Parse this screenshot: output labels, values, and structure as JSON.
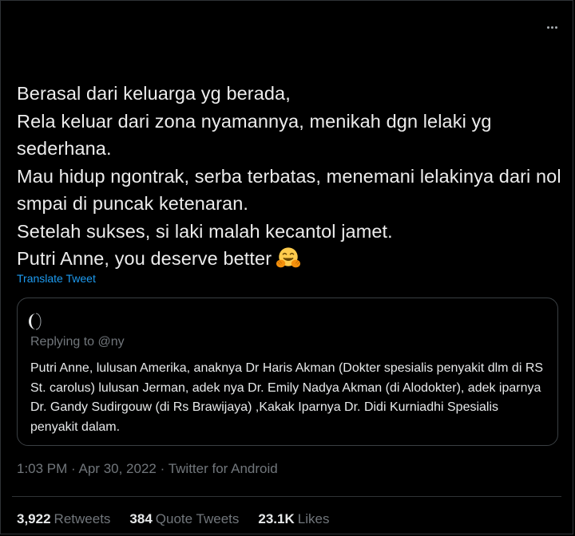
{
  "tweet": {
    "text": "Berasal dari keluarga yg berada,\nRela keluar dari zona nyamannya, menikah dgn lelaki yg sederhana.\nMau hidup ngontrak, serba terbatas, menemani lelakinya dari nol smpai di puncak ketenaran.\nSetelah sukses, si laki malah kecantol jamet.\nPutri Anne, you deserve better",
    "emoji": "hugging-face-emoji",
    "translate_label": "Translate Tweet"
  },
  "quoted_tweet": {
    "replying_prefix": "Replying to",
    "replying_handle": "@ny",
    "text": "Putri Anne, lulusan Amerika, anaknya Dr Haris Akman (Dokter spesialis penyakit dlm di RS St. carolus) lulusan Jerman, adek nya Dr. Emily Nadya Akman (di Alodokter), adek iparnya Dr. Gandy Sudirgouw (di Rs Brawijaya) ,Kakak Iparnya Dr. Didi Kurniadhi Spesialis penyakit dalam."
  },
  "meta": {
    "time": "1:03 PM",
    "date": "Apr 30, 2022",
    "source": "Twitter for Android"
  },
  "stats": {
    "retweets_count": "3,922",
    "retweets_label": "Retweets",
    "quotes_count": "384",
    "quotes_label": "Quote Tweets",
    "likes_count": "23.1K",
    "likes_label": "Likes"
  },
  "icons": {
    "more": "more-options-icon"
  },
  "colors": {
    "background": "#000000",
    "text": "#e7e9ea",
    "secondary": "#71767b",
    "link": "#1d9bf0",
    "border": "#2f3336"
  }
}
